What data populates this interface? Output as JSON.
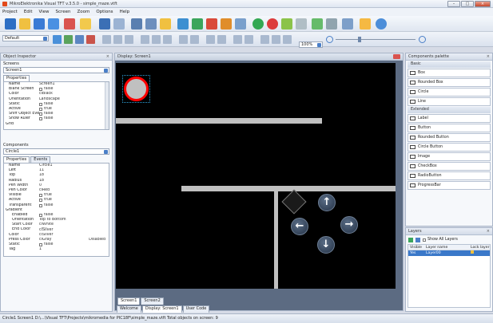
{
  "window": {
    "title": "MikroElektronika Visual TFT v.3.5.0 - simple_maze.vtft"
  },
  "menu": [
    "Project",
    "Edit",
    "View",
    "Screen",
    "Zoom",
    "Options",
    "Help"
  ],
  "toolbar": {
    "font_select": "Default",
    "zoom_value": "100%"
  },
  "object_inspector": {
    "title": "Object Inspector",
    "pin": "  ×",
    "screens_label": "Screens",
    "screen_value": "Screen1",
    "properties_tab": "Properties",
    "screen_props": [
      {
        "k": "Name",
        "v": "Screen1"
      },
      {
        "k": "Blank Screen",
        "v": "false",
        "chk": true
      },
      {
        "k": "Color",
        "v": "clBlack"
      },
      {
        "k": "Orientation",
        "v": "Landscape"
      },
      {
        "k": "Static",
        "v": "false",
        "chk": true
      },
      {
        "k": "Active",
        "v": "true",
        "chk": true
      },
      {
        "k": "Sniff Object Events",
        "v": "false",
        "chk": true
      },
      {
        "k": "Show Ruler",
        "v": "false",
        "chk": true
      },
      {
        "k": "Grid",
        "v": ""
      }
    ],
    "components_label": "Components",
    "component_value": "Circle1",
    "tabs": [
      "Properties",
      "Events"
    ],
    "component_props": [
      {
        "k": "Name",
        "v": "Circle1"
      },
      {
        "k": "Left",
        "v": "11"
      },
      {
        "k": "Top",
        "v": "18"
      },
      {
        "k": "Radius",
        "v": "18"
      },
      {
        "k": "Pen Width",
        "v": "0"
      },
      {
        "k": "Pen Color",
        "v": "clRed"
      },
      {
        "k": "Visible",
        "v": "true",
        "chk": true
      },
      {
        "k": "Active",
        "v": "true",
        "chk": true
      },
      {
        "k": "Transparent",
        "v": "false",
        "chk": true
      },
      {
        "k": "Gradient",
        "v": ""
      },
      {
        "k": "Enabled",
        "v": "false",
        "chk": true
      },
      {
        "k": "Orientation",
        "v": "Top to Bottom"
      },
      {
        "k": "Start Color",
        "v": "clWhite"
      },
      {
        "k": "End Color",
        "v": "clSilver"
      },
      {
        "k": "Color",
        "v": "clSilver"
      },
      {
        "k": "Press Color",
        "v": "clGray",
        "v2": "Disabled"
      },
      {
        "k": "Static",
        "v": "false",
        "chk": true
      },
      {
        "k": "Tag",
        "v": "1"
      }
    ]
  },
  "editor": {
    "title": "Display: Screen1",
    "bottom_tabs": [
      "Screen1",
      "Screen2"
    ],
    "doc_tabs": [
      "Welcome",
      "Display: Screen1",
      "User Code"
    ]
  },
  "palette": {
    "title": "Components palette",
    "pin": "×",
    "groups": [
      {
        "name": "Basic",
        "items": [
          "Box",
          "Rounded Box",
          "Circle",
          "Line"
        ]
      },
      {
        "name": "Extended",
        "items": [
          "Label",
          "Button",
          "Rounded Button",
          "Circle Button",
          "Image",
          "CheckBox",
          "RadioButton",
          "ProgressBar"
        ]
      }
    ]
  },
  "layers": {
    "title": "Layers",
    "show_all": "Show All Layers",
    "columns": [
      "Visible",
      "Layer name",
      "Lock layer"
    ],
    "rows": [
      {
        "visible": "Yes",
        "name": "Layer00"
      }
    ]
  },
  "status": {
    "text": "Circle1   Screen1   D:\\...\\Visual TFT\\Projects\\mikromedia for PIC18F\\simple_maze.vtft          Total objects on screen: 9"
  },
  "colors": {
    "canvas_bg": "#000000",
    "circle_fill": "#c0c0c0",
    "circle_pen": "#ff0000",
    "wall": "#c0c0c0",
    "selection": "#2f9fd6"
  },
  "icons": [
    "program-icon",
    "new-icon",
    "open-icon",
    "save-icon",
    "build-icon",
    "run-icon",
    "stop-icon",
    "help-icon"
  ]
}
